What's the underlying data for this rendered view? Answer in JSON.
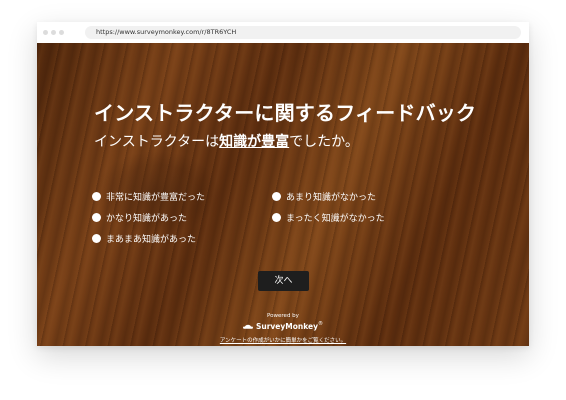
{
  "browser": {
    "url": "https://www.surveymonkey.com/r/8TR6YCH"
  },
  "survey": {
    "title": "インストラクターに関するフィードバック",
    "question_prefix": "インストラクターは",
    "question_keyword": "知識が豊富",
    "question_suffix": "でしたか。",
    "options": [
      "非常に知識が豊富だった",
      "かなり知識があった",
      "まあまあ知識があった",
      "あまり知識がなかった",
      "まったく知識がなかった"
    ],
    "next_label": "次へ"
  },
  "footer": {
    "powered_by": "Powered by",
    "brand": "SurveyMonkey",
    "trademark": "®",
    "link_text": "アンケートの作成がいかに簡単かをご覧ください。"
  },
  "colors": {
    "wood_background": "#6f3a14",
    "button_background": "#1e1e1e",
    "text": "#ffffff"
  }
}
